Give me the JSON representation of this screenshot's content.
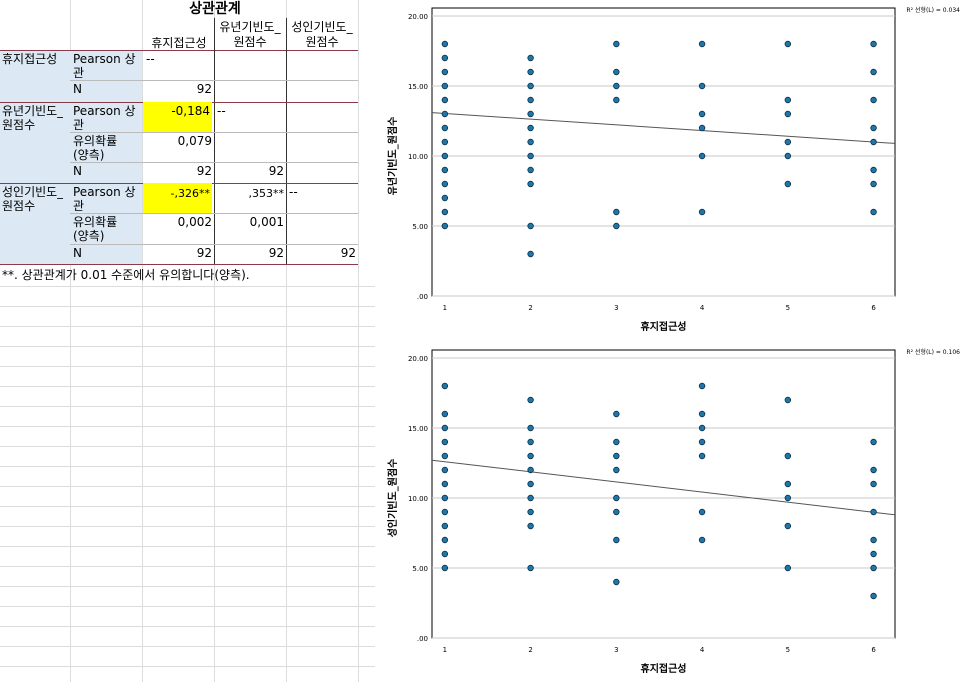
{
  "table": {
    "title": "상관관계",
    "col_headers": [
      "휴지접근성",
      "유년기빈도_\n원점수",
      "성인기빈도_\n원점수"
    ],
    "rows": [
      {
        "var": "휴지접근성",
        "pearson_label": "Pearson 상\n관",
        "pearson": [
          "--",
          "",
          ""
        ],
        "n_label": "N",
        "n": [
          "92",
          "",
          ""
        ]
      },
      {
        "var": "유년기빈도_\n원점수",
        "pearson_label": "Pearson 상\n관",
        "pearson": [
          "-0,184",
          "--",
          ""
        ],
        "sig_label": "유의확률\n(양측)",
        "sig": [
          "0,079",
          "",
          ""
        ],
        "n_label": "N",
        "n": [
          "92",
          "92",
          ""
        ]
      },
      {
        "var": "성인기빈도_\n원점수",
        "pearson_label": "Pearson 상\n관",
        "pearson": [
          "-,326**",
          ",353**",
          "--"
        ],
        "sig_label": "유의확률\n(양측)",
        "sig": [
          "0,002",
          "0,001",
          ""
        ],
        "n_label": "N",
        "n": [
          "92",
          "92",
          "92"
        ]
      }
    ],
    "footnote": "**. 상관관계가 0.01 수준에서 유의합니다(양측).",
    "highlight_color": "#ffff00",
    "rowhead_color": "#dce9f5"
  },
  "chart_data": [
    {
      "type": "scatter",
      "xlabel": "휴지접근성",
      "ylabel": "유년기빈도_원점수",
      "ylim": [
        0,
        20
      ],
      "yticks": [
        ".00",
        "5.00",
        "10.00",
        "15.00",
        "20.00"
      ],
      "xticks": [
        "1",
        "2",
        "3",
        "4",
        "5",
        "6"
      ],
      "fit_label": "R² 선형(L) = 0.034",
      "fit_line": {
        "x0": 0.85,
        "y0": 13.1,
        "x1": 6.25,
        "y1": 10.9
      },
      "points": [
        [
          1,
          18
        ],
        [
          1,
          17
        ],
        [
          1,
          16
        ],
        [
          1,
          15
        ],
        [
          1,
          14
        ],
        [
          1,
          13
        ],
        [
          1,
          12
        ],
        [
          1,
          11
        ],
        [
          1,
          10
        ],
        [
          1,
          9
        ],
        [
          1,
          8
        ],
        [
          1,
          7
        ],
        [
          1,
          6
        ],
        [
          1,
          5
        ],
        [
          2,
          17
        ],
        [
          2,
          16
        ],
        [
          2,
          15
        ],
        [
          2,
          14
        ],
        [
          2,
          13
        ],
        [
          2,
          12
        ],
        [
          2,
          11
        ],
        [
          2,
          10
        ],
        [
          2,
          9
        ],
        [
          2,
          8
        ],
        [
          2,
          5
        ],
        [
          2,
          3
        ],
        [
          3,
          18
        ],
        [
          3,
          16
        ],
        [
          3,
          15
        ],
        [
          3,
          14
        ],
        [
          3,
          6
        ],
        [
          3,
          5
        ],
        [
          4,
          18
        ],
        [
          4,
          15
        ],
        [
          4,
          13
        ],
        [
          4,
          12
        ],
        [
          4,
          10
        ],
        [
          4,
          6
        ],
        [
          5,
          18
        ],
        [
          5,
          14
        ],
        [
          5,
          13
        ],
        [
          5,
          11
        ],
        [
          5,
          10
        ],
        [
          5,
          8
        ],
        [
          6,
          18
        ],
        [
          6,
          16
        ],
        [
          6,
          14
        ],
        [
          6,
          12
        ],
        [
          6,
          11
        ],
        [
          6,
          9
        ],
        [
          6,
          8
        ],
        [
          6,
          6
        ]
      ],
      "point_color": "#1f77a9"
    },
    {
      "type": "scatter",
      "xlabel": "휴지접근성",
      "ylabel": "성인기빈도_원점수",
      "ylim": [
        0,
        20
      ],
      "yticks": [
        ".00",
        "5.00",
        "10.00",
        "15.00",
        "20.00"
      ],
      "xticks": [
        "1",
        "2",
        "3",
        "4",
        "5",
        "6"
      ],
      "fit_label": "R² 선형(L) = 0.106",
      "fit_line": {
        "x0": 0.85,
        "y0": 12.7,
        "x1": 6.25,
        "y1": 8.8
      },
      "points": [
        [
          1,
          18
        ],
        [
          1,
          16
        ],
        [
          1,
          15
        ],
        [
          1,
          14
        ],
        [
          1,
          13
        ],
        [
          1,
          12
        ],
        [
          1,
          11
        ],
        [
          1,
          10
        ],
        [
          1,
          9
        ],
        [
          1,
          8
        ],
        [
          1,
          7
        ],
        [
          1,
          6
        ],
        [
          1,
          5
        ],
        [
          2,
          17
        ],
        [
          2,
          15
        ],
        [
          2,
          14
        ],
        [
          2,
          13
        ],
        [
          2,
          12
        ],
        [
          2,
          11
        ],
        [
          2,
          10
        ],
        [
          2,
          9
        ],
        [
          2,
          8
        ],
        [
          2,
          5
        ],
        [
          3,
          16
        ],
        [
          3,
          14
        ],
        [
          3,
          13
        ],
        [
          3,
          12
        ],
        [
          3,
          10
        ],
        [
          3,
          9
        ],
        [
          3,
          7
        ],
        [
          3,
          4
        ],
        [
          4,
          18
        ],
        [
          4,
          16
        ],
        [
          4,
          15
        ],
        [
          4,
          14
        ],
        [
          4,
          13
        ],
        [
          4,
          9
        ],
        [
          4,
          7
        ],
        [
          5,
          17
        ],
        [
          5,
          13
        ],
        [
          5,
          11
        ],
        [
          5,
          10
        ],
        [
          5,
          8
        ],
        [
          5,
          5
        ],
        [
          6,
          14
        ],
        [
          6,
          12
        ],
        [
          6,
          11
        ],
        [
          6,
          9
        ],
        [
          6,
          7
        ],
        [
          6,
          6
        ],
        [
          6,
          5
        ],
        [
          6,
          3
        ]
      ],
      "point_color": "#1f77a9"
    }
  ]
}
